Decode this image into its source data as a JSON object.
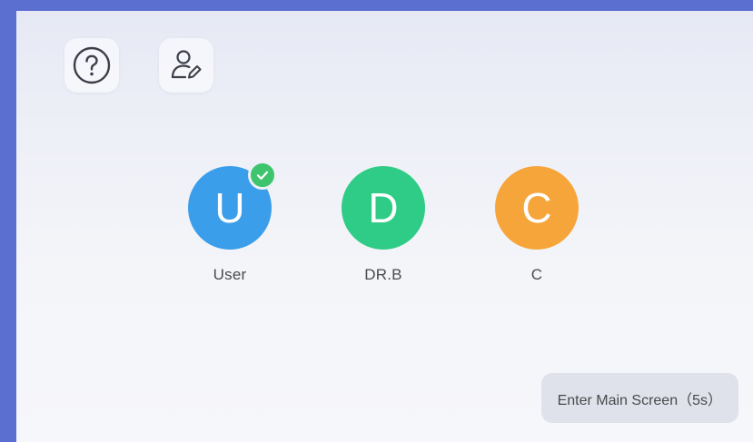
{
  "colors": {
    "frame": "#5b6fd1",
    "avatar_u": "#3a9eea",
    "avatar_d": "#2ecc86",
    "avatar_c": "#f6a53b",
    "check": "#3ec46d"
  },
  "toolbar": {
    "help_icon": "question-circle-icon",
    "edit_icon": "user-edit-icon"
  },
  "users": [
    {
      "initial": "U",
      "name": "User",
      "selected": true
    },
    {
      "initial": "D",
      "name": "DR.B",
      "selected": false
    },
    {
      "initial": "C",
      "name": "C",
      "selected": false
    }
  ],
  "footer": {
    "enter_label": "Enter Main Screen（5s）"
  }
}
